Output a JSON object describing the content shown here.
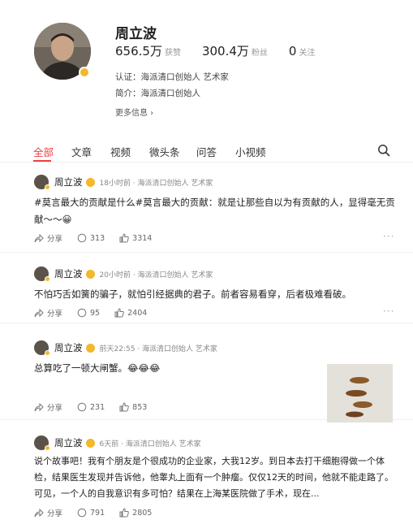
{
  "profile": {
    "name": "周立波",
    "likes": {
      "value": "656.5万",
      "label": "获赞"
    },
    "fans": {
      "value": "300.4万",
      "label": "粉丝"
    },
    "follows": {
      "value": "0",
      "label": "关注"
    },
    "certification": "认证：海派清口创始人 艺术家",
    "intro": "简介：海派清口创始人",
    "more_info": "更多信息 ›"
  },
  "tabs": [
    "全部",
    "文章",
    "视频",
    "微头条",
    "问答",
    "小视频"
  ],
  "active_tab": "全部",
  "posts": [
    {
      "author": "周立波",
      "time": "18小时前 · 海派清口创始人 艺术家",
      "text": "#莫言最大的贡献是什么#莫言最大的贡献：就是让那些自以为有贡献的人，显得毫无贡献～～😀",
      "share": "分享",
      "comments": "313",
      "likes": "3314"
    },
    {
      "author": "周立波",
      "time": "20小时前 · 海派清口创始人 艺术家",
      "text": "不怕巧舌如簧的骗子，就怕引经据典的君子。前者容易看穿，后者极难看破。",
      "share": "分享",
      "comments": "95",
      "likes": "2404"
    },
    {
      "author": "周立波",
      "time": "前天22:55 · 海派清口创始人 艺术家",
      "text": "总算吃了一顿大闸蟹。😂😂😂",
      "share": "分享",
      "comments": "231",
      "likes": "853"
    },
    {
      "author": "周立波",
      "time": "6天前 · 海派清口创始人 艺术家",
      "text": "说个故事吧！我有个朋友是个很成功的企业家，大我12岁。到日本去打干细胞得做一个体检，结果医生发现并告诉他，他睾丸上面有一个肿瘤。仅仅12天的时间，他就不能走路了。可见，一个人的自我意识有多可怕？结果在上海某医院做了手术，现在...",
      "share": "分享",
      "comments": "791",
      "likes": "2805"
    }
  ],
  "colors": {
    "accent": "#f04142",
    "verified": "#f3b82b"
  }
}
